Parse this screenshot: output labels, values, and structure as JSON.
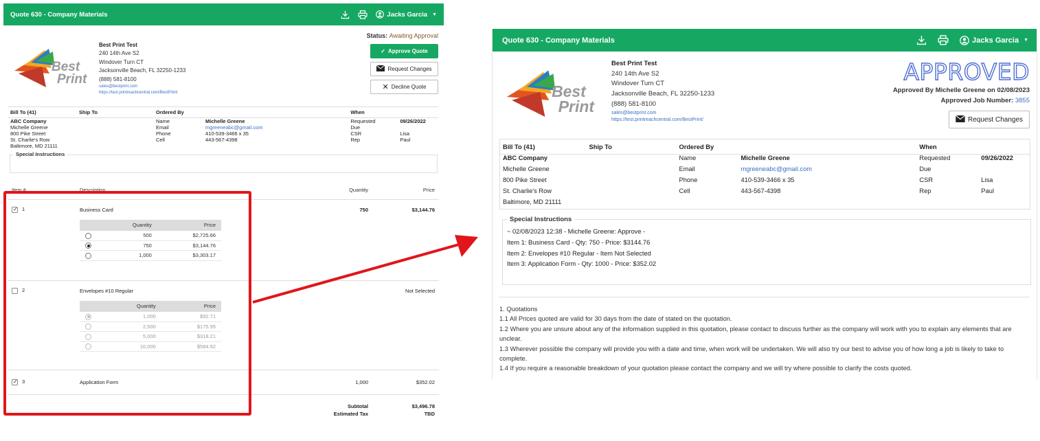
{
  "left": {
    "header": {
      "title": "Quote 630 - Company Materials",
      "user": "Jacks Garcia"
    },
    "company": {
      "name": "Best Print Test",
      "address1": "240 14th Ave S2",
      "address2": "Windover Turn CT",
      "city": "Jacksonville Beach, FL 32250-1233",
      "phone": "(888) 581-8100",
      "email": "sales@bestprint.com",
      "url": "https://test.printreachcentral.com/BestPrint/"
    },
    "status": {
      "label": "Status:",
      "value": "Awaiting Approval"
    },
    "buttons": {
      "approve": "Approve Quote",
      "request": "Request Changes",
      "decline": "Decline Quote"
    },
    "info": {
      "headers": {
        "bill_to": "Bill To (41)",
        "ship_to": "Ship To",
        "ordered_by": "Ordered By",
        "when": "When"
      },
      "bill": [
        "ABC Company",
        "Michelle Greene",
        "800 Pike Street",
        "St. Charlie's Row",
        "Baltimore, MD 21111"
      ],
      "ordered": [
        {
          "label": "Name",
          "value": "Michelle Greene"
        },
        {
          "label": "Email",
          "value": "mgreeneabc@gmail.com"
        },
        {
          "label": "Phone",
          "value": "410-539-3466 x 35"
        },
        {
          "label": "Cell",
          "value": "443-567-4398"
        }
      ],
      "when": [
        {
          "label": "Requested",
          "value": "09/26/2022"
        },
        {
          "label": "Due",
          "value": ""
        },
        {
          "label": "CSR",
          "value": "Lisa"
        },
        {
          "label": "Rep",
          "value": "Paul"
        }
      ]
    },
    "special": {
      "legend": "Special Instructions"
    },
    "items": {
      "headers": {
        "item": "Item #",
        "description": "Description",
        "quantity": "Quantity",
        "price": "Price"
      },
      "price_headers": {
        "quantity": "Quantity",
        "price": "Price"
      },
      "rows": [
        {
          "num": "1",
          "checked": true,
          "desc": "Business Card",
          "qty": "750",
          "price": "$3,144.76",
          "options": [
            {
              "qty": "500",
              "price": "$2,725.66",
              "selected": false
            },
            {
              "qty": "750",
              "price": "$3,144.76",
              "selected": true
            },
            {
              "qty": "1,000",
              "price": "$3,303.17",
              "selected": false
            }
          ]
        },
        {
          "num": "2",
          "checked": false,
          "desc": "Envelopes #10 Regular",
          "qty": "",
          "price": "Not Selected",
          "options": [
            {
              "qty": "1,000",
              "price": "$92.71",
              "selected": true
            },
            {
              "qty": "2,500",
              "price": "$175.95",
              "selected": false
            },
            {
              "qty": "5,000",
              "price": "$318.21",
              "selected": false
            },
            {
              "qty": "10,000",
              "price": "$584.92",
              "selected": false
            }
          ]
        },
        {
          "num": "3",
          "checked": true,
          "desc": "Application Form",
          "qty": "1,000",
          "price": "$352.02"
        }
      ],
      "subtotal_label": "Subtotal",
      "subtotal": "$3,496.78",
      "tax_label": "Estimated Tax",
      "tax": "TBD"
    }
  },
  "right": {
    "header": {
      "title": "Quote 630 - Company Materials",
      "user": "Jacks Garcia"
    },
    "company": {
      "name": "Best Print Test",
      "address1": "240 14th Ave S2",
      "address2": "Windover Turn CT",
      "city": "Jacksonville Beach, FL 32250-1233",
      "phone": "(888) 581-8100",
      "email": "sales@bestprint.com",
      "url": "https://test.printreachcentral.com/BestPrint/"
    },
    "approved": {
      "stamp": "APPROVED",
      "approved_by": "Approved By Michelle Greene on 02/08/2023",
      "job_label": "Approved Job Number:",
      "job_number": "3855",
      "request_button": "Request Changes"
    },
    "info": {
      "headers": {
        "bill_to": "Bill To (41)",
        "ship_to": "Ship To",
        "ordered_by": "Ordered By",
        "when": "When"
      },
      "bill": [
        "ABC Company",
        "Michelle Greene",
        "800 Pike Street",
        "St. Charlie's Row",
        "Baltimore, MD 21111"
      ],
      "ordered": [
        {
          "label": "Name",
          "value": "Michelle Greene"
        },
        {
          "label": "Email",
          "value": "mgreeneabc@gmail.com"
        },
        {
          "label": "Phone",
          "value": "410-539-3466 x 35"
        },
        {
          "label": "Cell",
          "value": "443-567-4398"
        }
      ],
      "when": [
        {
          "label": "Requested",
          "value": "09/26/2022"
        },
        {
          "label": "Due",
          "value": ""
        },
        {
          "label": "CSR",
          "value": "Lisa"
        },
        {
          "label": "Rep",
          "value": "Paul"
        }
      ]
    },
    "special": {
      "legend": "Special Instructions",
      "lines": [
        "~ 02/08/2023 12:38 - Michelle Greene: Approve -",
        "Item 1: Business Card - Qty: 750 - Price: $3144.76",
        "Item 2: Envelopes #10 Regular - Item Not Selected",
        "Item 3: Application Form - Qty: 1000 - Price: $352.02"
      ]
    },
    "terms": [
      "1. Quotations",
      "1.1 All Prices quoted are valid for 30 days from the date of stated on the quotation.",
      "1.2 Where you are unsure about any of the information supplied in this quotation, please contact to discuss further as the company will work with you to explain any elements that are unclear.",
      "1.3 Wherever possible the company will provide you with a date and time, when work will be undertaken. We will also try our best to advise you of how long a job is likely to take to complete.",
      "1.4 If you require a reasonable breakdown of your quotation please contact the company and we will try where possible to clarify the costs quoted."
    ]
  },
  "logo": {
    "word1": "Best",
    "word2": "Print"
  },
  "colors": {
    "brand_green": "#16a862",
    "highlight_red": "#e0161b",
    "link_blue": "#3b6fc4"
  }
}
